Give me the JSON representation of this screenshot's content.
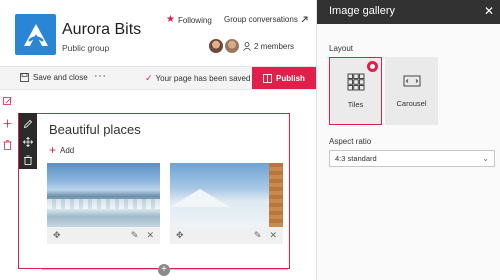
{
  "site": {
    "title": "Aurora Bits",
    "subtitle": "Public group",
    "follow_label": "Following",
    "group_conversations_label": "Group conversations",
    "members_label": "2 members"
  },
  "command_bar": {
    "save_close_label": "Save and close",
    "more_label": "···",
    "saved_status": "Your page has been saved",
    "publish_label": "Publish"
  },
  "webpart": {
    "title": "Beautiful places",
    "add_label": "Add",
    "images": [
      {
        "description": "sea waves under blue sky"
      },
      {
        "description": "snowy mountain with wooden post"
      }
    ]
  },
  "property_pane": {
    "title": "Image gallery",
    "layout_label": "Layout",
    "layout_options": [
      {
        "label": "Tiles",
        "selected": true
      },
      {
        "label": "Carousel",
        "selected": false
      }
    ],
    "aspect_ratio_label": "Aspect ratio",
    "aspect_ratio_value": "4:3 standard"
  },
  "colors": {
    "accent": "#e0204a",
    "pane_header": "#323232",
    "logo": "#2a85d4"
  }
}
